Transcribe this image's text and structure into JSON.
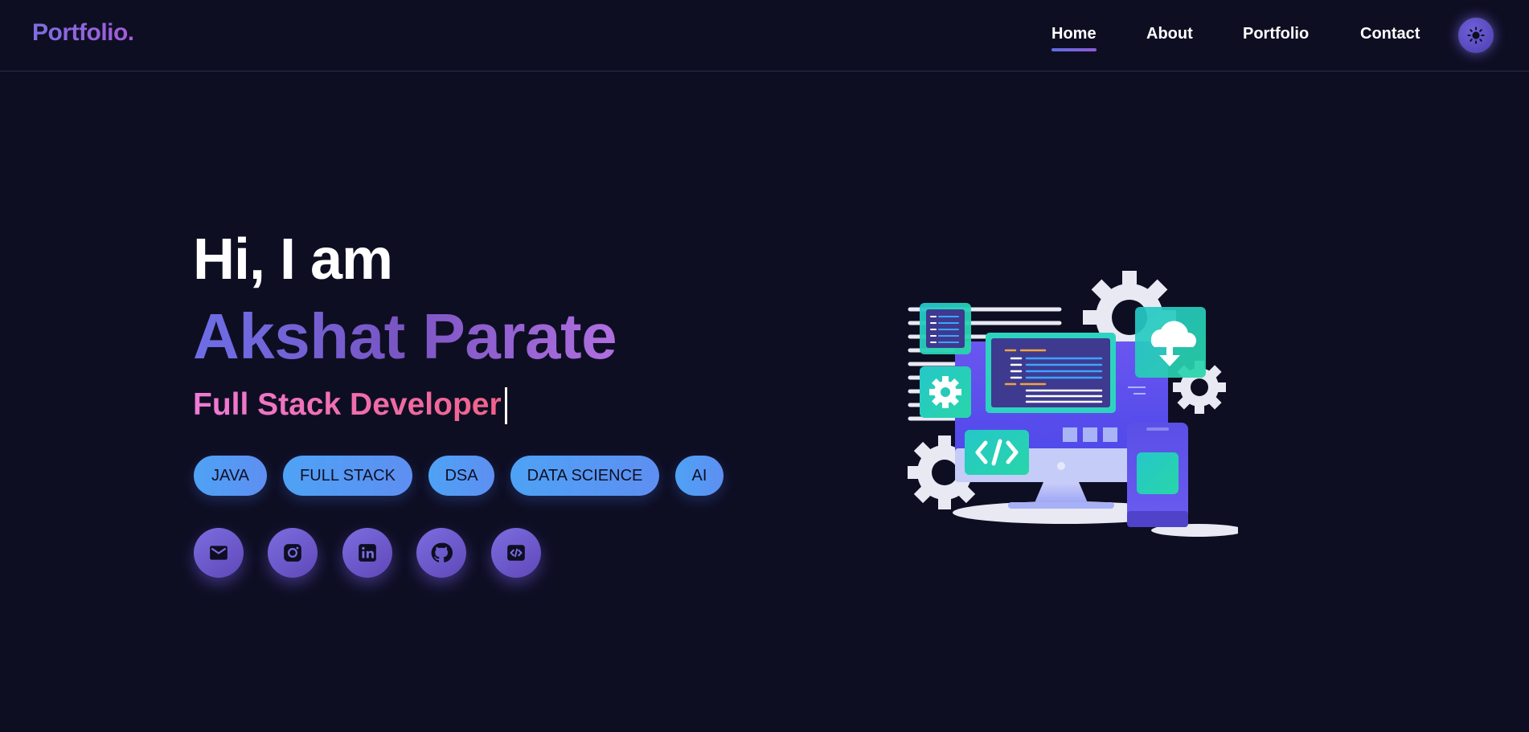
{
  "navbar": {
    "logo": "Portfolio.",
    "links": [
      {
        "label": "Home",
        "active": true
      },
      {
        "label": "About",
        "active": false
      },
      {
        "label": "Portfolio",
        "active": false
      },
      {
        "label": "Contact",
        "active": false
      }
    ],
    "theme_toggle_icon": "sun-icon"
  },
  "hero": {
    "greeting": "Hi, I am",
    "name": "Akshat Parate",
    "role": "Full Stack Developer",
    "skills": [
      "JAVA",
      "FULL STACK",
      "DSA",
      "DATA SCIENCE",
      "AI"
    ],
    "social_icons": [
      "mail-icon",
      "instagram-icon",
      "linkedin-icon",
      "github-icon",
      "code-icon"
    ],
    "illustration": "developer-workstation-illustration"
  },
  "colors": {
    "background": "#0e0e23",
    "accent_purple": "#7c6fe0",
    "role_gradient_start": "#f07ad6",
    "role_gradient_end": "#f0628a",
    "skill_pill": "#4ea2f5",
    "teal": "#2bd1b8"
  }
}
